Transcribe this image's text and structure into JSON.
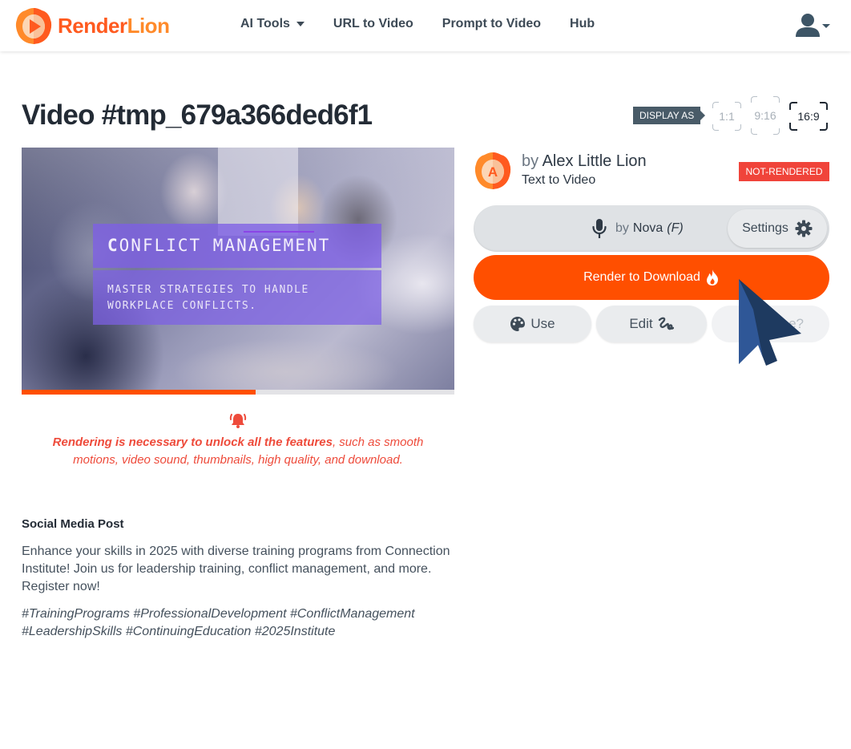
{
  "navbar": {
    "brand": {
      "part1": "Render",
      "part2": "Lion",
      "icon": "lion-play-logo-icon"
    },
    "links": [
      {
        "label": "AI Tools",
        "has_dropdown": true
      },
      {
        "label": "URL to Video",
        "has_dropdown": false
      },
      {
        "label": "Prompt to Video",
        "has_dropdown": false
      },
      {
        "label": "Hub",
        "has_dropdown": false
      }
    ],
    "user_menu": {
      "icon": "user-icon",
      "has_dropdown": true
    }
  },
  "page": {
    "title": "Video #tmp_679a366ded6f1",
    "display_as": {
      "label": "DISPLAY AS",
      "options": [
        {
          "label": "1:1",
          "selected": false
        },
        {
          "label": "9:16",
          "selected": false
        },
        {
          "label": "16:9",
          "selected": true
        }
      ]
    }
  },
  "video": {
    "headline_first": "C",
    "headline_rest": "ONFLICT MANAGEMENT",
    "subheadline": "MASTER STRATEGIES TO HANDLE WORKPLACE CONFLICTS.",
    "progress_percent": 54
  },
  "notice": {
    "icon": "bell-ringing-icon",
    "bold": "Rendering is necessary to unlock all the features",
    "rest": ", such as smooth motions, video sound, thumbnails, high quality, and download."
  },
  "social": {
    "title": "Social Media Post",
    "body": "Enhance your skills in 2025 with diverse training programs from Connection Institute! Join us for leadership training, conflict management, and more. Register now!",
    "hashtags": "#TrainingPrograms #ProfessionalDevelopment #ConflictManagement #LeadershipSkills #ContinuingEducation #2025Institute"
  },
  "author": {
    "avatar_letter": "A",
    "by": "by",
    "name": "Alex Little Lion",
    "type": "Text to Video",
    "status": "NOT-RENDERED"
  },
  "voice": {
    "by": "by",
    "name": "Nova",
    "gender": "(F)",
    "settings_label": "Settings"
  },
  "actions": {
    "render_label": "Render to Download",
    "use_label": "Use",
    "edit_label": "Edit",
    "third_label_visible": "e?"
  },
  "colors": {
    "brand_orange": "#ff4f00",
    "badge_red": "#f0443a",
    "notice_red": "#ee4b3b",
    "overlay_purple": "#7d5fe6",
    "cursor_blue": "#2d5592"
  }
}
